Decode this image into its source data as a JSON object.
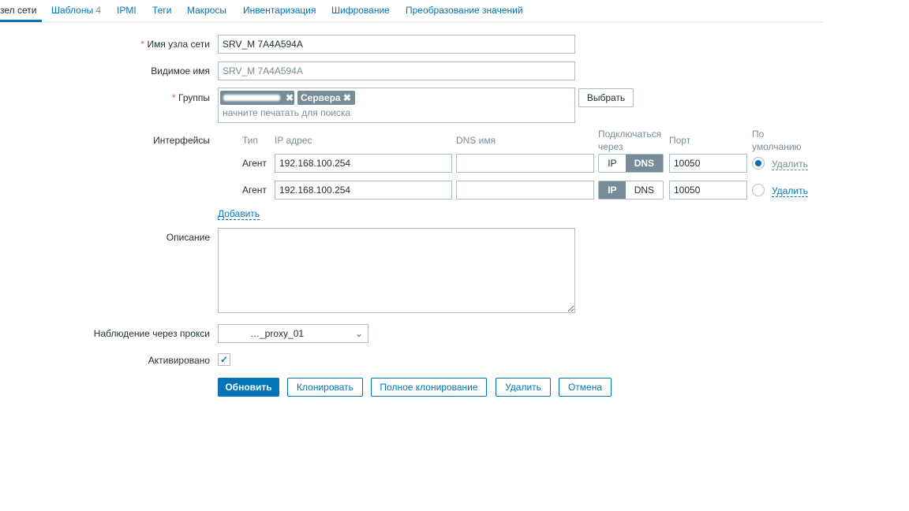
{
  "tabs": [
    {
      "label": "зел сети",
      "active": true
    },
    {
      "label": "Шаблоны",
      "count": "4"
    },
    {
      "label": "IPMI"
    },
    {
      "label": "Теги"
    },
    {
      "label": "Макросы"
    },
    {
      "label": "Инвентаризация"
    },
    {
      "label": "Шифрование"
    },
    {
      "label": "Преобразование значений"
    }
  ],
  "form": {
    "host_name_label": "Имя узла сети",
    "host_name": "SRV_M 7A4A594A",
    "visible_name_label": "Видимое имя",
    "visible_name_placeholder": "SRV_M 7A4A594A",
    "groups_label": "Группы",
    "groups": [
      "",
      "Сервера"
    ],
    "groups_placeholder": "начните печатать для поиска",
    "select_button": "Выбрать",
    "interfaces_label": "Интерфейсы",
    "interface_headers": {
      "type": "Тип",
      "ip": "IP адрес",
      "dns": "DNS имя",
      "connect_via": "Подключаться через",
      "port": "Порт",
      "default": "По умолчанию"
    },
    "interfaces": [
      {
        "type": "Агент",
        "ip": "192.168.100.254",
        "dns": "",
        "connect_via": "DNS",
        "port": "10050",
        "default": true,
        "remove": "Удалить"
      },
      {
        "type": "Агент",
        "ip": "192.168.100.254",
        "dns": "",
        "connect_via": "IP",
        "port": "10050",
        "default": false,
        "remove": "Удалить"
      }
    ],
    "toggle_ip": "IP",
    "toggle_dns": "DNS",
    "add_link": "Добавить",
    "description_label": "Описание",
    "description": "",
    "proxy_label": "Наблюдение через прокси",
    "proxy_value": "…_proxy_01",
    "enabled_label": "Активировано",
    "enabled": true,
    "buttons": {
      "update": "Обновить",
      "clone": "Клонировать",
      "full_clone": "Полное клонирование",
      "delete": "Удалить",
      "cancel": "Отмена"
    }
  },
  "colors": {
    "accent": "#0275b8",
    "tag": "#768d99",
    "required": "#e45959"
  }
}
